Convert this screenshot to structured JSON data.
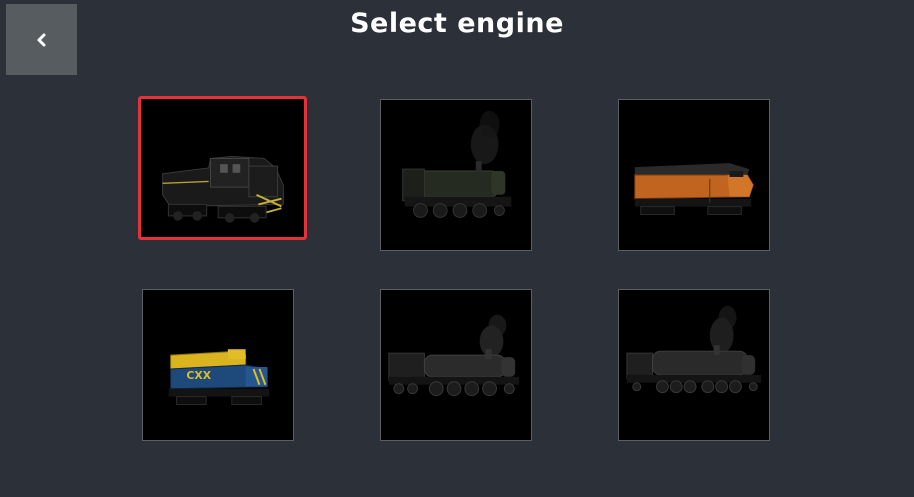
{
  "header": {
    "title": "Select engine",
    "back_icon": "chevron-left-icon"
  },
  "engines": [
    {
      "icon": "diesel-switcher-locomotive-icon",
      "selected": true
    },
    {
      "icon": "steam-tank-locomotive-icon",
      "selected": false
    },
    {
      "icon": "orange-diesel-cab-locomotive-icon",
      "selected": false
    },
    {
      "icon": "csx-diesel-locomotive-icon",
      "selected": false
    },
    {
      "icon": "large-steam-locomotive-icon",
      "selected": false
    },
    {
      "icon": "articulated-steam-locomotive-icon",
      "selected": false
    }
  ],
  "colors": {
    "background": "#2c3038",
    "back_button": "#575c61",
    "selection_border": "#e2323a",
    "tile_border": "#5b5f64"
  }
}
